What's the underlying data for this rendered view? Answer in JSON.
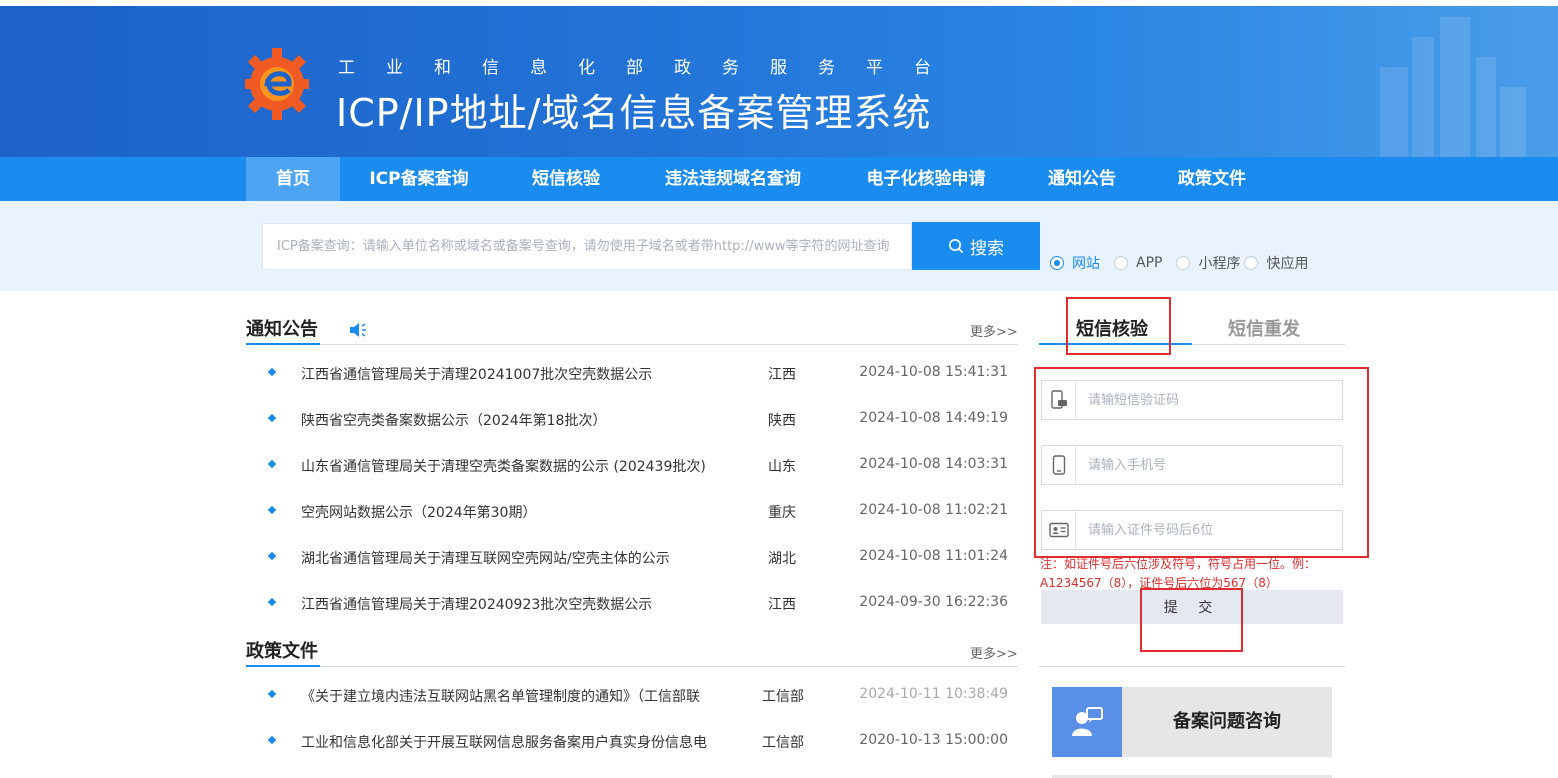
{
  "header": {
    "subtitle": "工业和信息化部政务服务平台",
    "title": "ICP/IP地址/域名信息备案管理系统",
    "logo": "miit-gear-logo"
  },
  "nav": {
    "items": [
      {
        "label": "首页",
        "active": true
      },
      {
        "label": "ICP备案查询",
        "active": false
      },
      {
        "label": "短信核验",
        "active": false
      },
      {
        "label": "违法违规域名查询",
        "active": false
      },
      {
        "label": "电子化核验申请",
        "active": false
      },
      {
        "label": "通知公告",
        "active": false
      },
      {
        "label": "政策文件",
        "active": false
      }
    ]
  },
  "search": {
    "placeholder": "ICP备案查询：请输入单位名称或域名或备案号查询，请勿使用子域名或者带http://www等字符的网址查询",
    "button_label": "搜索",
    "options": [
      {
        "label": "网站",
        "checked": true
      },
      {
        "label": "APP",
        "checked": false
      },
      {
        "label": "小程序",
        "checked": false
      },
      {
        "label": "快应用",
        "checked": false
      }
    ]
  },
  "notices": {
    "title": "通知公告",
    "more": "更多>>",
    "items": [
      {
        "title": "江西省通信管理局关于清理20241007批次空壳数据公示",
        "province": "江西",
        "date": "2024-10-08 15:41:31"
      },
      {
        "title": "陕西省空壳类备案数据公示（2024年第18批次）",
        "province": "陕西",
        "date": "2024-10-08 14:49:19"
      },
      {
        "title": "山东省通信管理局关于清理空壳类备案数据的公示 (202439批次)",
        "province": "山东",
        "date": "2024-10-08 14:03:31"
      },
      {
        "title": "空壳网站数据公示（2024年第30期）",
        "province": "重庆",
        "date": "2024-10-08 11:02:21"
      },
      {
        "title": "湖北省通信管理局关于清理互联网空壳网站/空壳主体的公示",
        "province": "湖北",
        "date": "2024-10-08 11:01:24"
      },
      {
        "title": "江西省通信管理局关于清理20240923批次空壳数据公示",
        "province": "江西",
        "date": "2024-09-30 16:22:36"
      }
    ]
  },
  "policies": {
    "title": "政策文件",
    "more": "更多>>",
    "items": [
      {
        "title": "《关于建立境内违法互联网站黑名单管理制度的通知》（工信部联",
        "province": "工信部",
        "date": "2024-10-11 10:38:49"
      },
      {
        "title": "工业和信息化部关于开展互联网信息服务备案用户真实身份信息电",
        "province": "工信部",
        "date": "2020-10-13 15:00:00"
      }
    ]
  },
  "sms_panel": {
    "tab_verify": "短信核验",
    "tab_resend": "短信重发",
    "code_placeholder": "请输短信验证码",
    "phone_placeholder": "请输入手机号",
    "id_placeholder": "请输入证件号码后6位",
    "note": "注：如证件号后六位涉及符号，符号占用一位。例：A1234567（8），证件号后六位为567（8）",
    "submit_label": "提 交"
  },
  "consult": {
    "label": "备案问题咨询"
  },
  "colors": {
    "primary": "#1a8cf0",
    "banner": "#2272d6",
    "highlight_box": "#e02c2c"
  }
}
